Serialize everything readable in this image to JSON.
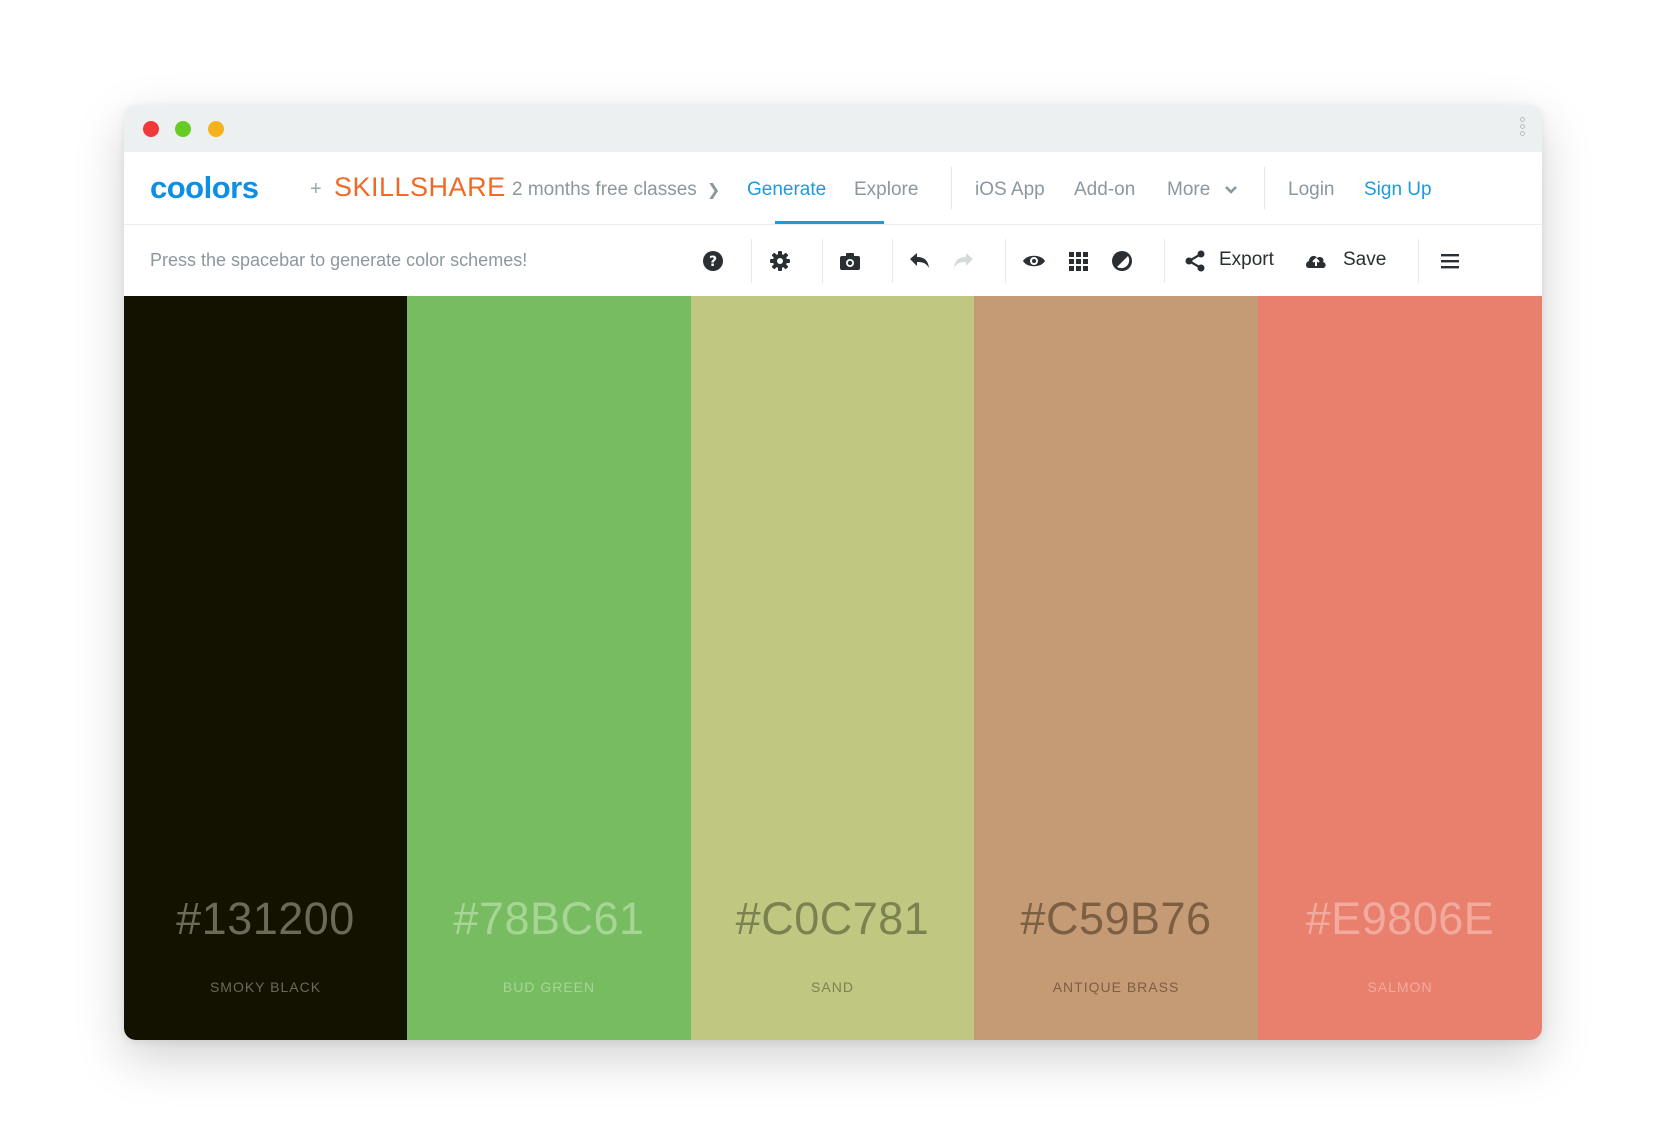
{
  "navbar": {
    "logo": "coolors",
    "plus": "+",
    "partner": "SKILLSHARE",
    "promo": "2 months free classes",
    "links": {
      "generate": "Generate",
      "explore": "Explore",
      "ios_app": "iOS App",
      "addon": "Add-on",
      "more": "More",
      "login": "Login",
      "signup": "Sign Up"
    }
  },
  "toolbar": {
    "hint": "Press the spacebar to generate color schemes!",
    "export_label": "Export",
    "save_label": "Save"
  },
  "palette": [
    {
      "hex": "#131200",
      "name": "SMOKY BLACK",
      "color": "#131200",
      "text_color": "#6b6a56"
    },
    {
      "hex": "#78BC61",
      "name": "BUD GREEN",
      "color": "#78bc61",
      "text_color": "#a6d595"
    },
    {
      "hex": "#C0C781",
      "name": "SAND",
      "color": "#c0c781",
      "text_color": "#7c8150"
    },
    {
      "hex": "#C59B76",
      "name": "ANTIQUE BRASS",
      "color": "#c59b76",
      "text_color": "#7c5e43"
    },
    {
      "hex": "#E9806E",
      "name": "SALMON",
      "color": "#e9806e",
      "text_color": "#f2aa9e"
    }
  ],
  "colors": {
    "accent": "#1a9ae0",
    "nav_text": "#8c979e"
  }
}
